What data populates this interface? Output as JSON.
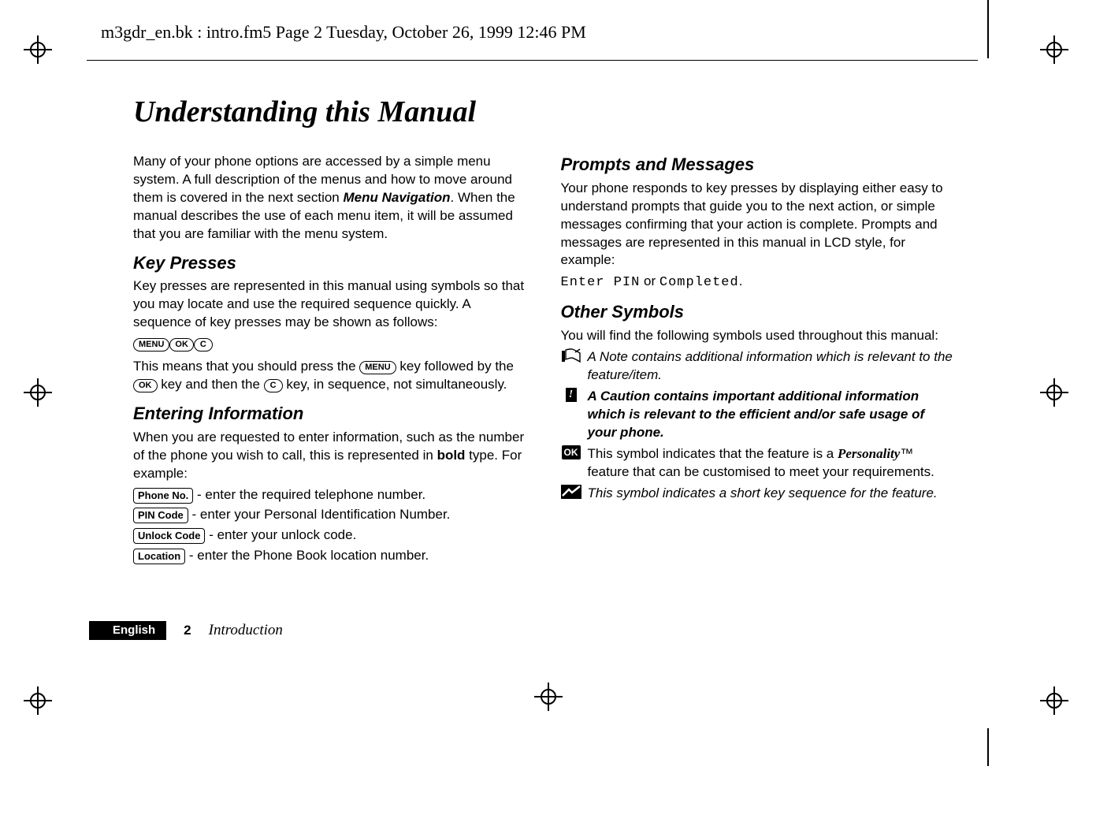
{
  "header_runner": "m3gdr_en.bk : intro.fm5  Page 2  Tuesday, October 26, 1999  12:46 PM",
  "main_title": "Understanding this Manual",
  "intro_para_1": "Many of your phone options are accessed by a simple menu system. A full description of the menus and how to move around them is covered in the next section ",
  "intro_menu_nav": "Menu Navigation",
  "intro_para_2": ". When the manual describes the use of each menu item, it will be assumed that you are familiar with the menu system.",
  "h_key_presses": "Key Presses",
  "key_presses_para": "Key presses are represented in this manual using symbols so that you may locate and use the required sequence quickly. A sequence of key presses may be shown as follows:",
  "keys": {
    "menu": "MENU",
    "ok": "OK",
    "c": "C"
  },
  "key_seq_explain_1": "This means that you should press the ",
  "key_seq_explain_2": " key followed by the ",
  "key_seq_explain_3": " key and then the ",
  "key_seq_explain_4": " key, in sequence, not simultaneously.",
  "h_entering": "Entering Information",
  "entering_para_1": "When you are requested to enter information, such as the number of the phone you wish to call, this is represented in ",
  "entering_bold": "bold",
  "entering_para_2": " type. For example:",
  "entries": [
    {
      "label": "Phone No.",
      "desc": " - enter the required telephone number."
    },
    {
      "label": "PIN Code",
      "desc": " - enter your Personal Identification Number."
    },
    {
      "label": "Unlock Code",
      "desc": " - enter your unlock code."
    },
    {
      "label": "Location",
      "desc": " - enter the Phone Book location number."
    }
  ],
  "h_prompts": "Prompts and Messages",
  "prompts_para": "Your phone responds to key presses by displaying either easy to understand prompts that guide you to the next action, or simple messages confirming that your action is complete. Prompts and messages are represented in this manual in LCD style, for example:",
  "lcd_example_1": "Enter PIN",
  "lcd_or": " or ",
  "lcd_example_2": "Completed",
  "lcd_period": ".",
  "h_other": "Other Symbols",
  "other_intro": "You will find the following symbols used throughout this manual:",
  "note_text": "A Note contains additional information which is relevant to the feature/item.",
  "caution_text": "A Caution contains important additional information which is relevant to the efficient and/or safe usage of your phone.",
  "ok_sym_text_1": "This symbol indicates that the feature is a ",
  "personality": "Personality",
  "tm": "™",
  "ok_sym_text_2": " feature that can be customised to meet your requirements.",
  "shortcut_text": "This symbol indicates a short key sequence for the feature.",
  "ok_badge": "OK",
  "bang_badge": "!",
  "footer": {
    "language": "English",
    "page_num": "2",
    "section": "Introduction"
  }
}
